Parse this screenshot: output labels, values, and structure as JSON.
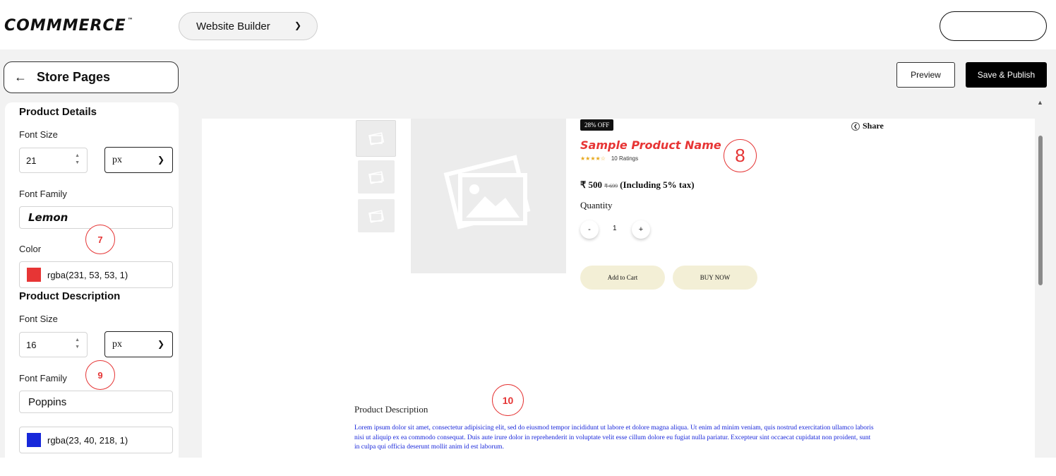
{
  "header": {
    "logo": "COMMMERCE",
    "logo_tm": "™",
    "builder_select": "Website Builder"
  },
  "toolbar": {
    "back_label": "Store Pages",
    "preview_label": "Preview",
    "publish_label": "Save & Publish"
  },
  "panel": {
    "product_details": {
      "title": "Product Details",
      "font_size_label": "Font Size",
      "font_size_value": "21",
      "font_size_unit": "px",
      "font_family_label": "Font Family",
      "font_family_value": "Lemon",
      "color_label": "Color",
      "color_value": "rgba(231, 53, 53, 1)",
      "color_hex": "#e73535"
    },
    "product_description": {
      "title": "Product Description",
      "font_size_label": "Font Size",
      "font_size_value": "16",
      "font_size_unit": "px",
      "font_family_label": "Font Family",
      "font_family_value": "Poppins",
      "color_value": "rgba(23, 40, 218, 1)",
      "color_hex": "#1728da"
    }
  },
  "annotations": {
    "badge_7": "7",
    "badge_8": "8",
    "badge_9": "9",
    "badge_10": "10"
  },
  "product": {
    "discount": "28% OFF",
    "share_label": "Share",
    "name": "Sample Product Name",
    "stars": "★★★★☆",
    "ratings": "10 Ratings",
    "price": "₹ 500",
    "old_price": "₹ 699",
    "tax_note": "(Including 5% tax)",
    "quantity_label": "Quantity",
    "qty_minus": "-",
    "qty_value": "1",
    "qty_plus": "+",
    "add_to_cart": "Add to Cart",
    "buy_now": "BUY NOW",
    "description_title": "Product Description",
    "description_text": "Lorem ipsum dolor sit amet, consectetur adipisicing elit, sed do eiusmod tempor incididunt ut labore et dolore magna aliqua. Ut enim ad minim veniam, quis nostrud exercitation ullamco laboris nisi ut aliquip ex ea commodo consequat. Duis aute irure dolor in reprehenderit in voluptate velit esse cillum dolore eu fugiat nulla pariatur. Excepteur sint occaecat cupidatat non proident, sunt in culpa qui officia deserunt mollit anim id est laborum."
  }
}
